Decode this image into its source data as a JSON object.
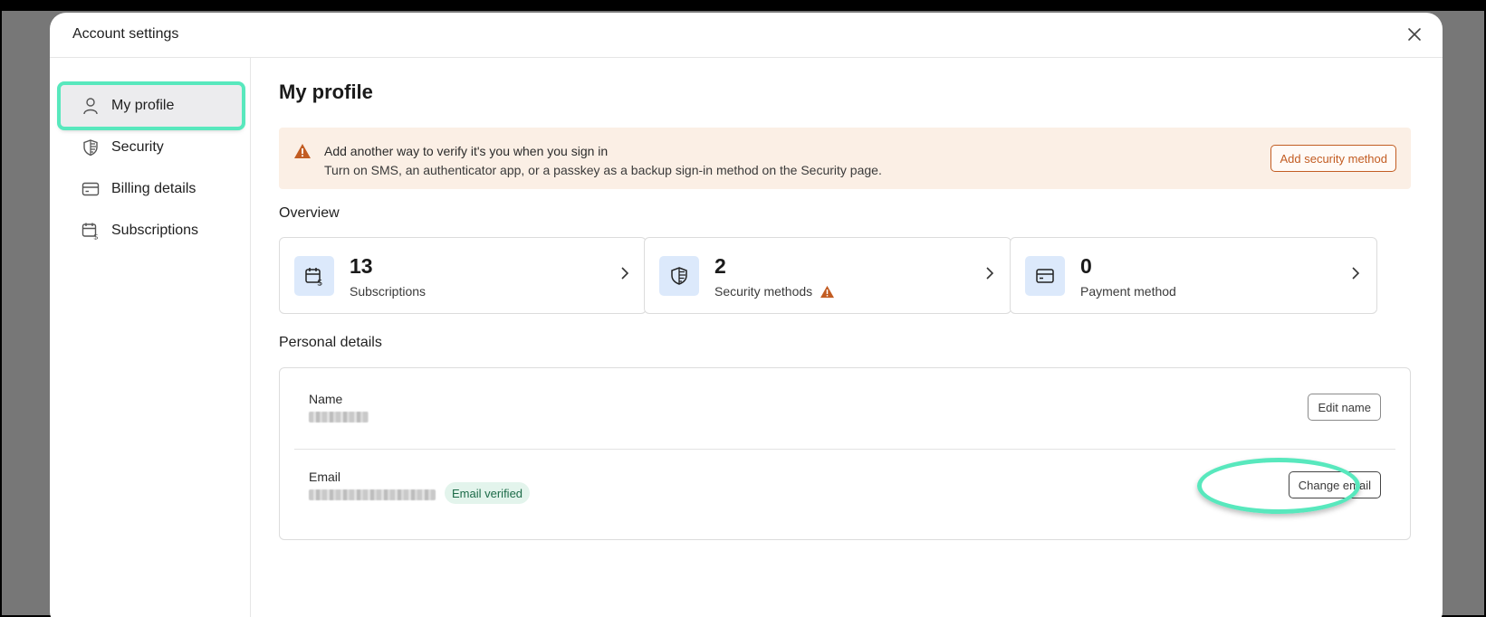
{
  "modal": {
    "title": "Account settings"
  },
  "sidebar": {
    "items": [
      {
        "label": "My profile",
        "icon": "person-icon",
        "active": true
      },
      {
        "label": "Security",
        "icon": "shield-icon",
        "active": false
      },
      {
        "label": "Billing details",
        "icon": "credit-card-icon",
        "active": false
      },
      {
        "label": "Subscriptions",
        "icon": "calendar-dollar-icon",
        "active": false
      }
    ]
  },
  "main": {
    "title": "My profile",
    "alert": {
      "title": "Add another way to verify it's you when you sign in",
      "body": "Turn on SMS, an authenticator app, or a passkey as a backup sign-in method on the Security page.",
      "button": "Add security method"
    },
    "overview": {
      "heading": "Overview",
      "cards": [
        {
          "value": "13",
          "label": "Subscriptions",
          "icon": "calendar-dollar-icon"
        },
        {
          "value": "2",
          "label": "Security methods",
          "icon": "shield-icon",
          "warning": true
        },
        {
          "value": "0",
          "label": "Payment method",
          "icon": "credit-card-icon"
        }
      ]
    },
    "personal": {
      "heading": "Personal details",
      "name_label": "Name",
      "edit_name_button": "Edit name",
      "email_label": "Email",
      "email_badge": "Email verified",
      "change_email_button": "Change email"
    }
  },
  "colors": {
    "highlight": "#58e8bd",
    "alert_bg": "#fbefe5",
    "alert_accent": "#c25c22",
    "icon_bg": "#dce9fb",
    "verified_bg": "#e3f4ec",
    "verified_text": "#1c6b48"
  }
}
